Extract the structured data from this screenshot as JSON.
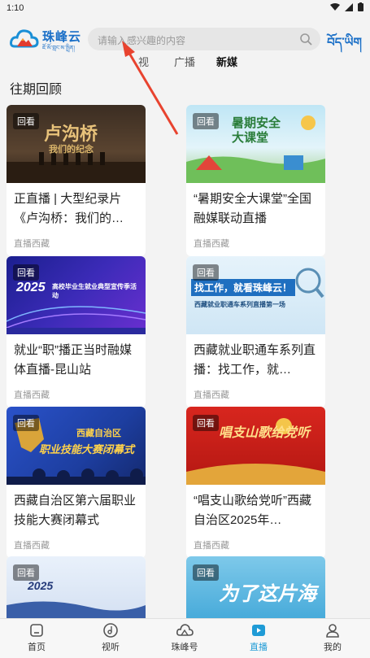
{
  "status": {
    "time": "1:10"
  },
  "header": {
    "logo_text": "珠峰云",
    "logo_sub": "ཇོ་མོ་གླང་མ་སྤྲིན།",
    "search_placeholder": "请输入感兴趣的内容",
    "tibetan_button": "བོད་ཡིག"
  },
  "tabs": [
    {
      "label": "视"
    },
    {
      "label": "广播"
    },
    {
      "label": "新媒"
    }
  ],
  "section": {
    "title": "往期回顾"
  },
  "cards": [
    {
      "badge": "回看",
      "thumb_text": "卢沟桥",
      "thumb_sub": "我们的纪念",
      "title": "正直播 | 大型纪录片《卢沟桥：我们的…",
      "source": "直播西藏"
    },
    {
      "badge": "回看",
      "thumb_text": "暑期安全大课堂",
      "thumb_sub": "",
      "title": "“暑期安全大课堂”全国融媒联动直播",
      "source": "直播西藏"
    },
    {
      "badge": "回看",
      "thumb_text": "2025",
      "thumb_sub": "高校毕业生就业典型宣传季活动",
      "title": "就业“职”播正当时融媒体直播-昆山站",
      "source": "直播西藏"
    },
    {
      "badge": "回看",
      "thumb_text": "找工作，就看珠峰云！",
      "thumb_sub": "西藏就业职通车系列直播第一场",
      "title": "西藏就业职通车系列直播：找工作，就…",
      "source": "直播西藏"
    },
    {
      "badge": "回看",
      "thumb_text": "职业技能大赛闭幕式",
      "thumb_sub": "西藏自治区",
      "title": "西藏自治区第六届职业技能大赛闭幕式",
      "source": "直播西藏"
    },
    {
      "badge": "回看",
      "thumb_text": "唱支山歌给党听",
      "thumb_sub": "",
      "title": "“唱支山歌给党听”西藏自治区2025年…",
      "source": "直播西藏"
    },
    {
      "badge": "回看",
      "thumb_text": "2025",
      "thumb_sub": "",
      "title": "",
      "source": ""
    },
    {
      "badge": "回看",
      "thumb_text": "为了这片海",
      "thumb_sub": "",
      "title": "",
      "source": ""
    }
  ],
  "nav": [
    {
      "label": "首页",
      "icon": "home-icon"
    },
    {
      "label": "视听",
      "icon": "music-icon"
    },
    {
      "label": "珠峰号",
      "icon": "cloud-icon"
    },
    {
      "label": "直播",
      "icon": "live-icon"
    },
    {
      "label": "我的",
      "icon": "user-icon"
    }
  ],
  "colors": {
    "accent": "#1f9bd6",
    "brand": "#1a6fc7"
  }
}
